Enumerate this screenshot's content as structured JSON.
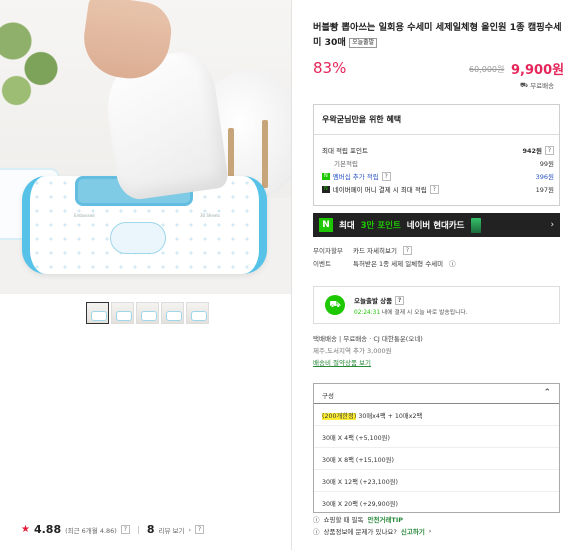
{
  "product": {
    "title": "버블빵 뽑아쓰는 일회용 수세미 세제일체형 올인원 1종 캠핑수세미 30매",
    "today_tag": "오늘출발",
    "discount": "83%",
    "original_price": "60,000원",
    "sale_price": "9,900원",
    "shipping": "무료배송"
  },
  "gallery": {
    "thumbnails": [
      "thumb-1",
      "thumb-2",
      "thumb-3",
      "thumb-4",
      "thumb-5"
    ],
    "active_index": 0,
    "pack_label_left": "Embossed",
    "pack_label_right": "30 Sheets"
  },
  "rating": {
    "score": "4.88",
    "recent": "(최근 6개월 4.86)",
    "review_count": "8",
    "review_label": "리뷰 보기"
  },
  "benefits": {
    "heading": "우왁굳님만을 위한 혜택",
    "max_points_label": "최대 적립 포인트",
    "max_points_value": "942원",
    "rows": [
      {
        "label": "기본적립",
        "value": "99원"
      },
      {
        "chip": "N",
        "label": "멤버십 추가 적립",
        "value": "396원"
      },
      {
        "chip": "N",
        "label": "네이버페이 머니 결제 시 최대 적립",
        "value": "197원"
      }
    ]
  },
  "card_banner": {
    "n_logo": "N",
    "prefix": "최대",
    "highlight": "3만 포인트",
    "suffix": "네이버 현대카드",
    "arrow": "›"
  },
  "payment": {
    "interest_key": "무이자할부",
    "interest_val": "카드 자세히보기",
    "event_key": "이벤트",
    "event_val": "특허받은 1종 세제 일체형 수세미"
  },
  "today_delivery": {
    "title": "오늘출발 상품",
    "deadline": "02:24:31",
    "desc": "내에 결제 시 오늘 바로 발송됩니다."
  },
  "shipping": {
    "line1": "택배배송 | 무료배송 · CJ 대한통운(오네)",
    "line2": "제주,도서지역 추가 3,000원",
    "link": "배송비 절약상품 보기"
  },
  "options": {
    "placeholder": "구성",
    "items": [
      {
        "highlight": "(200개한정)",
        "text": " 30매x4팩 + 10매x2팩"
      },
      {
        "highlight": "",
        "text": "30매 X 4팩 (+5,100원)"
      },
      {
        "highlight": "",
        "text": "30매 X 8팩 (+15,100원)"
      },
      {
        "highlight": "",
        "text": "30매 X 12팩 (+23,100원)"
      },
      {
        "highlight": "",
        "text": "30매 X 20팩 (+29,900원)"
      }
    ]
  },
  "bottom": {
    "safe_prefix": "쇼핑할 때 필독",
    "safe_link": "안전거래TIP",
    "report_prefix": "상품정보에 문제가 있나요?",
    "report_link": "신고하기"
  },
  "colors": {
    "accent_red": "#e5265a",
    "naver_green": "#1ec800",
    "option_highlight": "#ffef34"
  }
}
